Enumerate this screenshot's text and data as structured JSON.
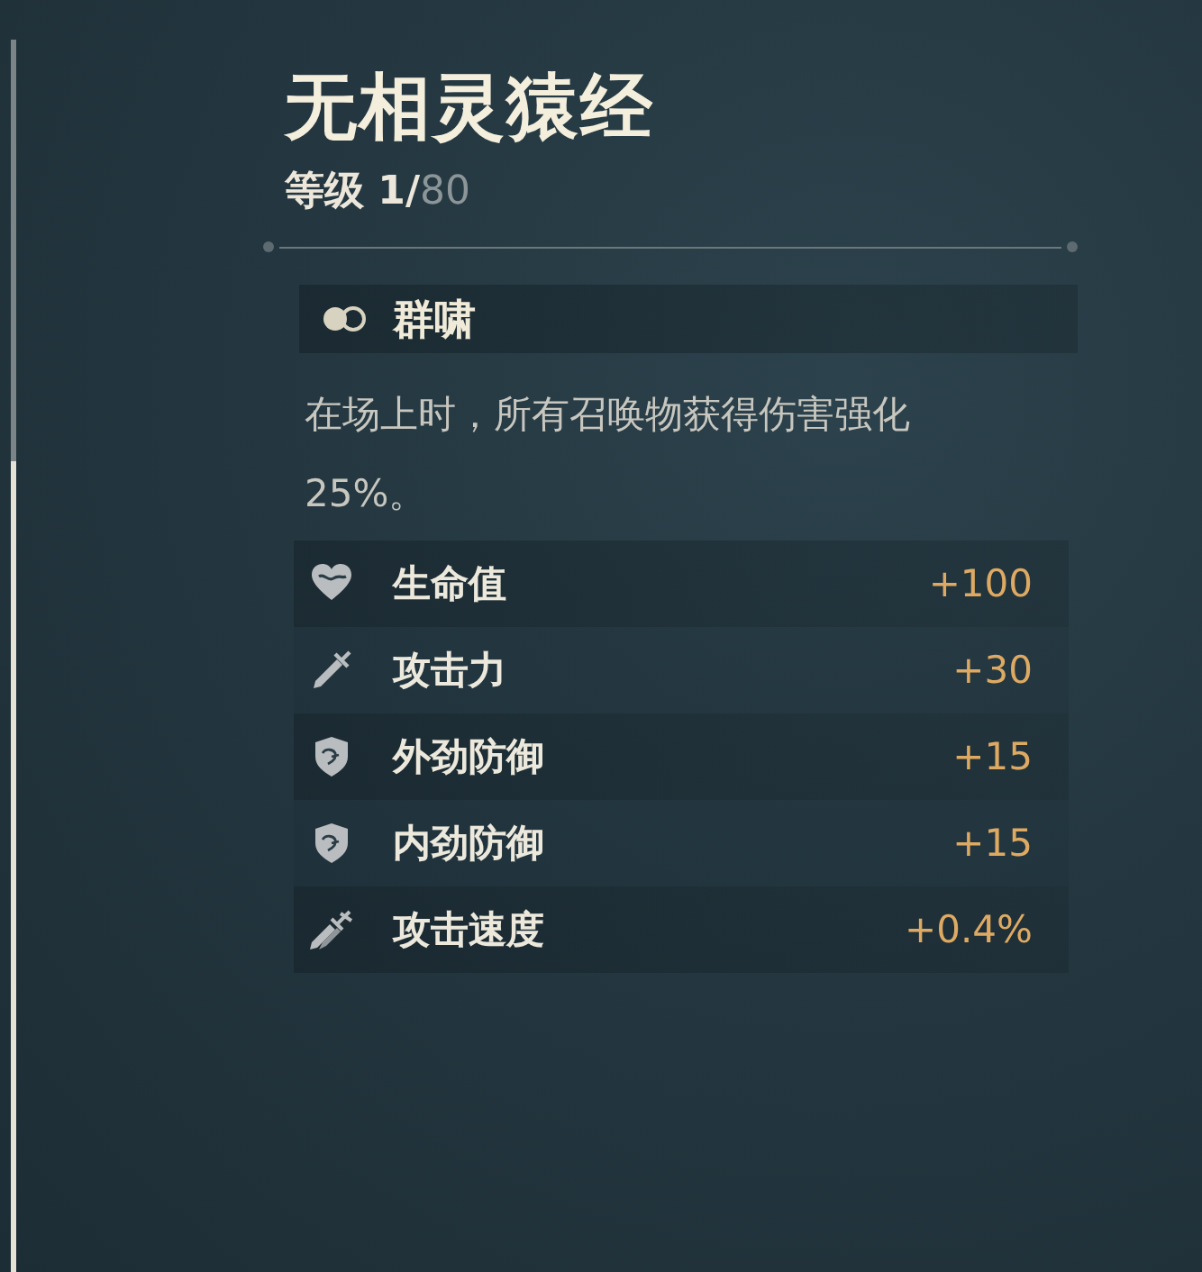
{
  "title": "无相灵猿经",
  "level": {
    "text": "等级 1/",
    "max": "80"
  },
  "skill": {
    "name": "群啸",
    "description": "在场上时，所有召唤物获得伤害强化25%。"
  },
  "stats": [
    {
      "kind": "heart",
      "label": "生命值",
      "value": "+100"
    },
    {
      "kind": "sword",
      "label": "攻击力",
      "value": "+30"
    },
    {
      "kind": "shield",
      "label": "外劲防御",
      "value": "+15"
    },
    {
      "kind": "shield",
      "label": "内劲防御",
      "value": "+15"
    },
    {
      "kind": "swords",
      "label": "攻击速度",
      "value": "+0.4%"
    }
  ]
}
